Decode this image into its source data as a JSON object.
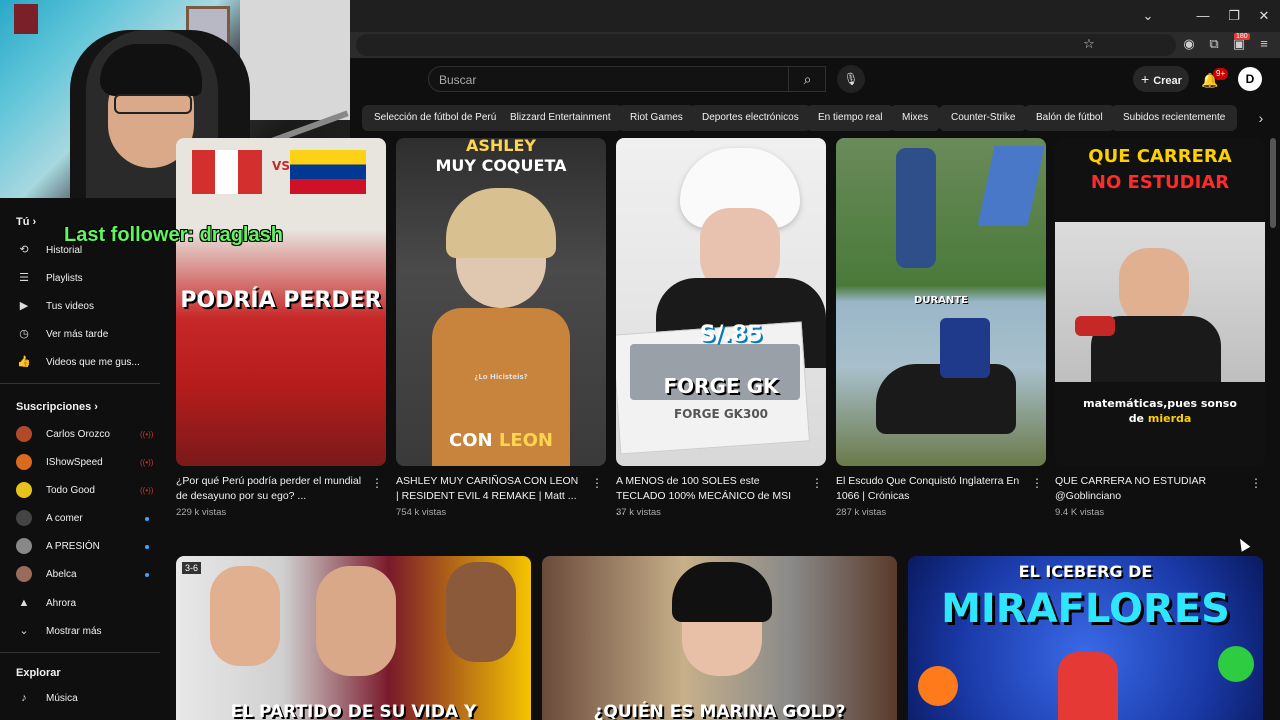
{
  "browser": {
    "controls": {
      "minimize": "—",
      "restore": "❐",
      "close": "✕",
      "dropdown": "⌄"
    },
    "ext_badge": "180"
  },
  "header": {
    "search_placeholder": "Buscar",
    "create_label": "Crear",
    "notif_count": "9+",
    "avatar_letter": "D"
  },
  "chips": [
    "Selección de fútbol de Perú",
    "Blizzard Entertainment",
    "Riot Games",
    "Deportes electrónicos",
    "En tiempo real",
    "Mixes",
    "Counter-Strike",
    "Balón de fútbol",
    "Subidos recientemente"
  ],
  "overlay": {
    "last_follower": "Last follower: draglash"
  },
  "sidebar": {
    "you_title": "Tú",
    "you_items": [
      {
        "label": "Historial",
        "icon": "history-icon"
      },
      {
        "label": "Playlists",
        "icon": "playlists-icon"
      },
      {
        "label": "Tus videos",
        "icon": "your-videos-icon"
      },
      {
        "label": "Ver más tarde",
        "icon": "watch-later-icon"
      },
      {
        "label": "Videos que me gus...",
        "icon": "liked-videos-icon"
      }
    ],
    "subs_title": "Suscripciones",
    "subs": [
      {
        "label": "Carlos Orozco",
        "status": "live",
        "color": "#b24a2a"
      },
      {
        "label": "IShowSpeed",
        "status": "live",
        "color": "#d96a1e"
      },
      {
        "label": "Todo Good",
        "status": "live",
        "color": "#e6c21a"
      },
      {
        "label": "A comer",
        "status": "new",
        "color": "#444444"
      },
      {
        "label": "A PRESIÓN",
        "status": "new",
        "color": "#888888"
      },
      {
        "label": "Abelca",
        "status": "new",
        "color": "#9a6a5a"
      },
      {
        "label": "Ahrora",
        "status": "",
        "color": "#dddddd"
      }
    ],
    "show_more": "Mostrar más",
    "explore_title": "Explorar",
    "explore_items": [
      {
        "label": "Música",
        "icon": "music-icon"
      }
    ]
  },
  "videos": [
    {
      "title": "¿Por qué Perú podría perder el mundial de desayuno por su ego? ...",
      "views": "229 k vistas",
      "thumb_text": "PODRÍA PERDER",
      "thumb_text2": "VS",
      "colors": [
        "#c62828",
        "#f5f5f5",
        "#1565c0"
      ]
    },
    {
      "title": "ASHLEY MUY CARIÑOSA CON LEON | RESIDENT EVIL 4 REMAKE | Matt ...",
      "views": "754 k vistas",
      "thumb_text": "ASHLEY",
      "thumb_text2": "MUY COQUETA",
      "thumb_text3": "CON",
      "thumb_text4": "LEON",
      "thumb_caption": "¿Lo Hicisteis?",
      "colors": [
        "#3a3a3a",
        "#c8843c",
        "#ffd54f"
      ]
    },
    {
      "title": "A MENOS de 100 SOLES este TECLADO 100% MECÁNICO de MSI ...",
      "views": "37 k vistas",
      "thumb_text": "S/.85",
      "thumb_text2": "FORGE GK",
      "thumb_text3": "FORGE GK300",
      "colors": [
        "#e9e9e9",
        "#1a1a1a",
        "#7ad9ff"
      ]
    },
    {
      "title": "El Escudo Que Conquistó Inglaterra En 1066 | Crónicas",
      "views": "287 k vistas",
      "thumb_text": "DURANTE",
      "colors": [
        "#4a7a3a",
        "#2e4f8a",
        "#9ab6c8"
      ]
    },
    {
      "title": "QUE CARRERA NO ESTUDIAR @Goblinciano",
      "views": "9.4 K vistas",
      "thumb_text": "QUE CARRERA",
      "thumb_text2": "NO ESTUDIAR",
      "thumb_text3": "matemáticas,pues sonso de",
      "thumb_text4": "mierda",
      "colors": [
        "#111111",
        "#ffd000",
        "#ff2a2a"
      ]
    }
  ],
  "videos_row2": [
    {
      "thumb_text": "EL PARTIDO DE SU VIDA Y",
      "badge": "3-6",
      "colors": [
        "#7a1a2a",
        "#f5c400",
        "#e0e0e0"
      ]
    },
    {
      "thumb_text": "¿QUIÉN ES MARINA GOLD?",
      "colors": [
        "#5a3a2a",
        "#c7c7c7",
        "#ff5aa0"
      ]
    },
    {
      "thumb_text": "EL ICEBERG DE",
      "thumb_text2": "MIRAFLORES",
      "colors": [
        "#1a3aa8",
        "#ffffff",
        "#2ee6ff"
      ]
    }
  ]
}
